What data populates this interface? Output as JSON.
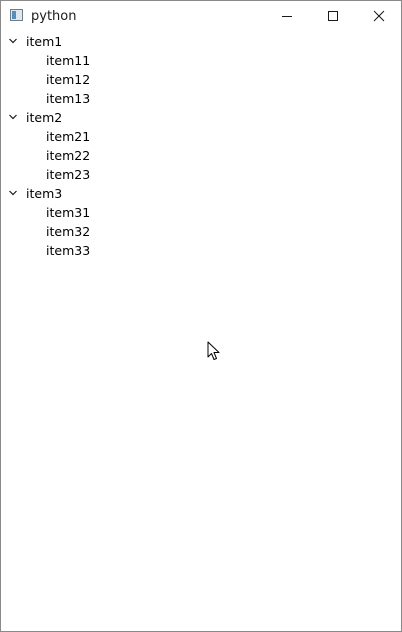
{
  "window": {
    "title": "python",
    "controls": [
      "minimize",
      "maximize",
      "close"
    ]
  },
  "tree": [
    {
      "label": "item1",
      "expanded": true,
      "children": [
        {
          "label": "item11"
        },
        {
          "label": "item12"
        },
        {
          "label": "item13"
        }
      ]
    },
    {
      "label": "item2",
      "expanded": true,
      "children": [
        {
          "label": "item21"
        },
        {
          "label": "item22"
        },
        {
          "label": "item23"
        }
      ]
    },
    {
      "label": "item3",
      "expanded": true,
      "children": [
        {
          "label": "item31"
        },
        {
          "label": "item32"
        },
        {
          "label": "item33"
        }
      ]
    }
  ],
  "icons": {
    "expand": "chevron-down-icon",
    "app": "app-window-icon",
    "pointer": "mouse-pointer-icon"
  }
}
